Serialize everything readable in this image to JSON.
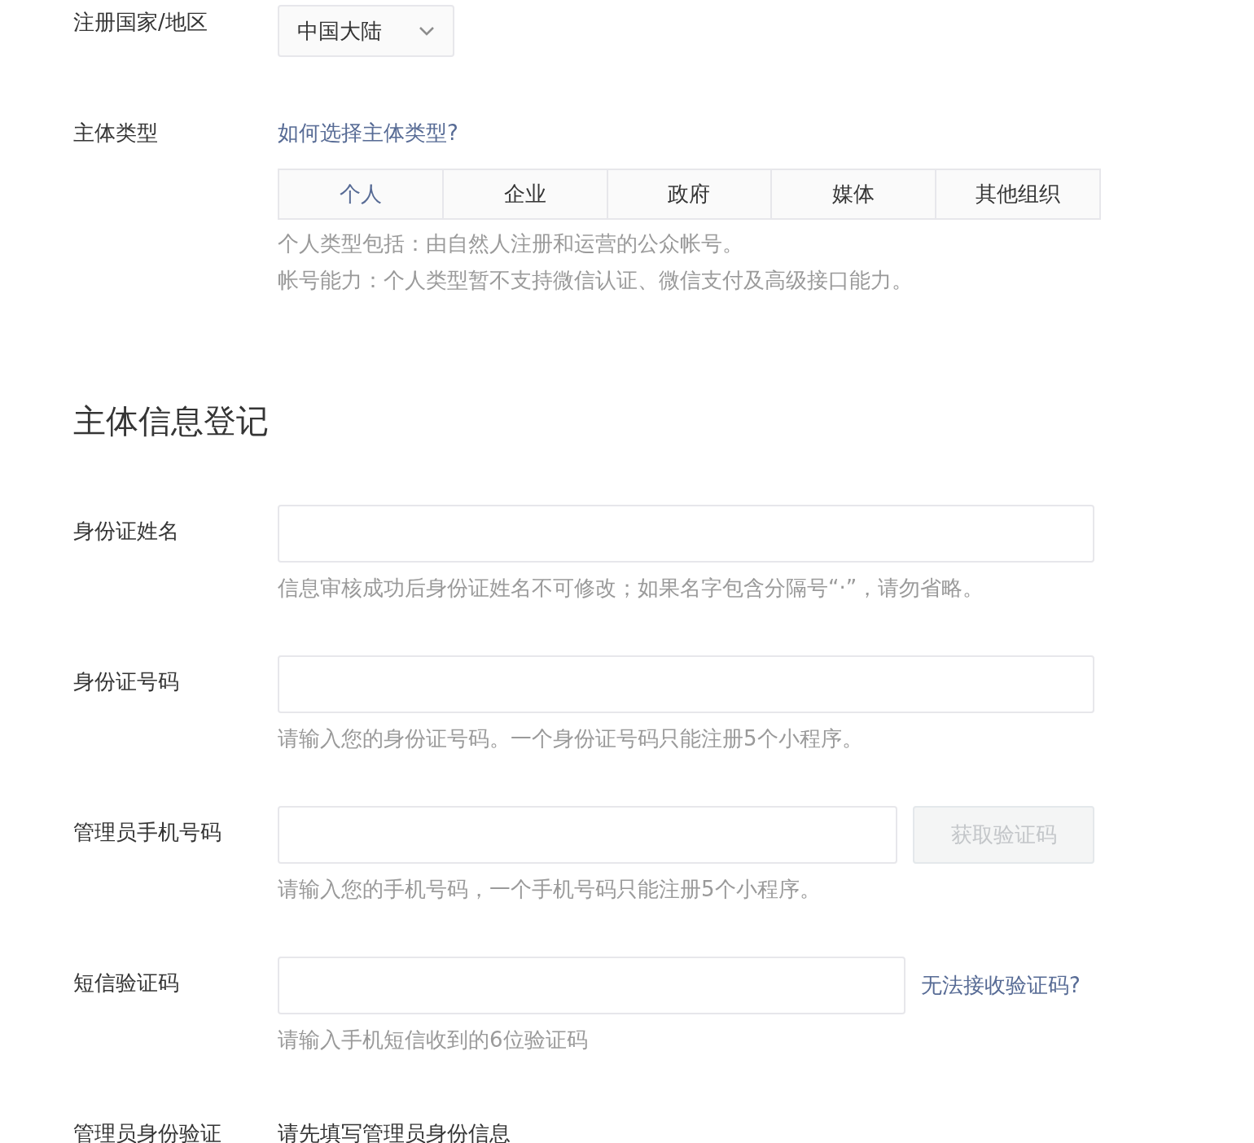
{
  "region": {
    "label": "注册国家/地区",
    "value": "中国大陆"
  },
  "entity_type": {
    "label": "主体类型",
    "help_link": "如何选择主体类型?",
    "options": [
      {
        "label": "个人",
        "selected": true
      },
      {
        "label": "企业",
        "selected": false
      },
      {
        "label": "政府",
        "selected": false
      },
      {
        "label": "媒体",
        "selected": false
      },
      {
        "label": "其他组织",
        "selected": false
      }
    ],
    "hints": [
      "个人类型包括：由自然人注册和运营的公众帐号。",
      "帐号能力：个人类型暂不支持微信认证、微信支付及高级接口能力。"
    ]
  },
  "section_title": "主体信息登记",
  "fields": [
    {
      "kind": "text",
      "label": "身份证姓名",
      "hint": "信息审核成功后身份证姓名不可修改；如果名字包含分隔号“·”，请勿省略。"
    },
    {
      "kind": "text",
      "label": "身份证号码",
      "hint": "请输入您的身份证号码。一个身份证号码只能注册5个小程序。"
    },
    {
      "kind": "button",
      "label": "管理员手机号码",
      "button": {
        "label": "获取验证码",
        "disabled": true
      },
      "hint": "请输入您的手机号码，一个手机号码只能注册5个小程序。"
    },
    {
      "kind": "link",
      "label": "短信验证码",
      "link": "无法接收验证码?",
      "hint": "请输入手机短信收到的6位验证码"
    }
  ],
  "admin_verify": {
    "label": "管理员身份验证",
    "text": "请先填写管理员身份信息"
  }
}
